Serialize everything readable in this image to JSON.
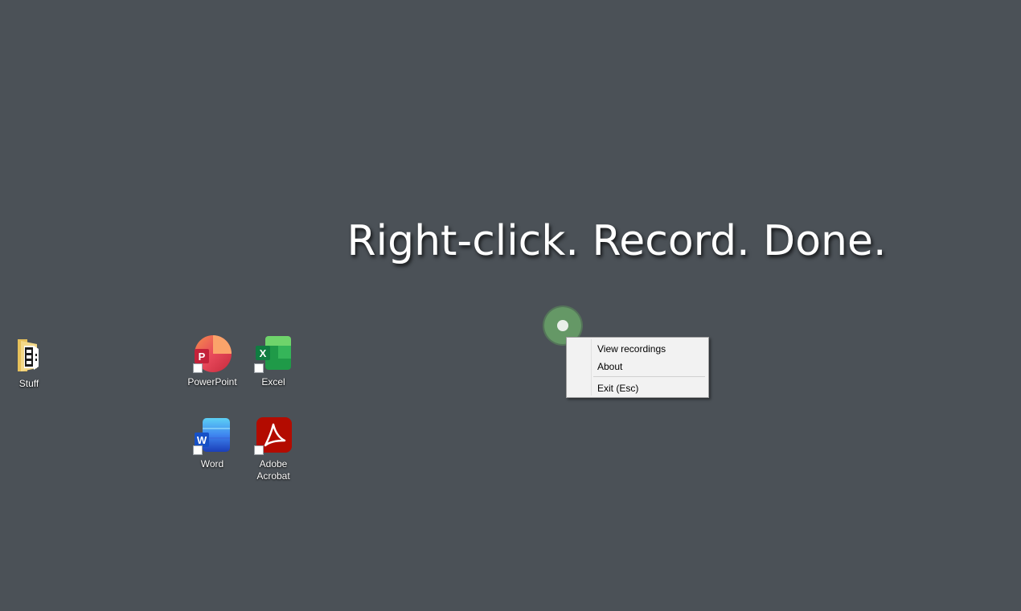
{
  "headline": "Right-click. Record. Done.",
  "desktop_icons": [
    {
      "label": "Stuff",
      "icon": "folder-icon"
    },
    {
      "label": "PowerPoint",
      "icon": "powerpoint-icon"
    },
    {
      "label": "Excel",
      "icon": "excel-icon"
    },
    {
      "label": "Word",
      "icon": "word-icon"
    },
    {
      "label": "Adobe Acrobat",
      "icon": "adobe-acrobat-icon"
    }
  ],
  "context_menu": {
    "items": [
      "View recordings",
      "About",
      "Exit (Esc)"
    ]
  },
  "colors": {
    "desktop_background": "#4b5157",
    "recorder_green": "#68a068",
    "menu_background": "#f2f2f2"
  }
}
